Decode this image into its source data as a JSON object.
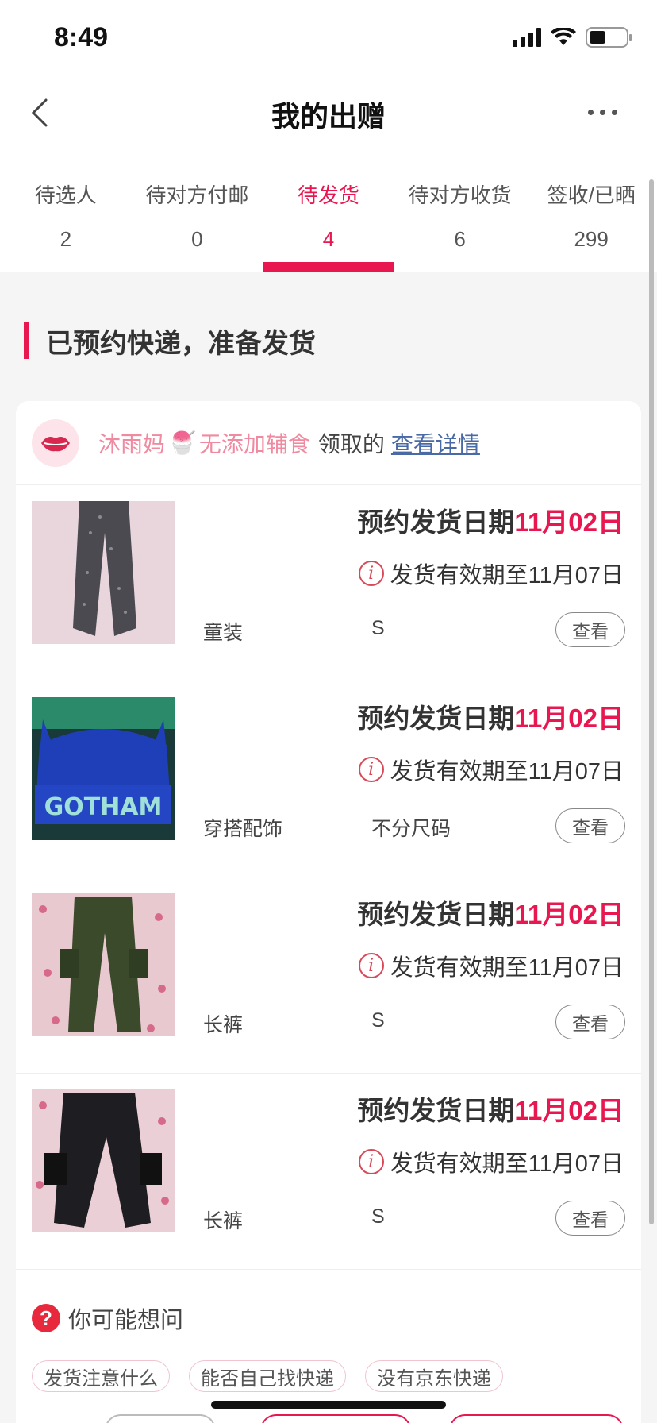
{
  "status_bar": {
    "time": "8:49",
    "battery_level": 0.45
  },
  "nav": {
    "title": "我的出赠"
  },
  "tabs": [
    {
      "label": "待选人",
      "count": "2"
    },
    {
      "label": "待对方付邮",
      "count": "0"
    },
    {
      "label": "待发货",
      "count": "4",
      "active": true
    },
    {
      "label": "待对方收货",
      "count": "6"
    },
    {
      "label": "签收/已晒",
      "count": "299"
    }
  ],
  "section": {
    "title": "已预约快递，准备发货"
  },
  "giver": {
    "name": "沐雨妈",
    "emoji": "🍧",
    "suffix": "无添加辅食",
    "action": "领取的",
    "link": "查看详情"
  },
  "items": [
    {
      "date_label": "预约发货日期",
      "date_value": "11月02日",
      "valid_text": "发货有效期至11月07日",
      "category": "童装",
      "size": "S",
      "view_label": "查看",
      "thumb": "gray-pants-icon"
    },
    {
      "date_label": "预约发货日期",
      "date_value": "11月02日",
      "valid_text": "发货有效期至11月07日",
      "category": "穿搭配饰",
      "size": "不分尺码",
      "view_label": "查看",
      "thumb": "blue-hat-icon",
      "thumb_text": "GOTHAM"
    },
    {
      "date_label": "预约发货日期",
      "date_value": "11月02日",
      "valid_text": "发货有效期至11月07日",
      "category": "长裤",
      "size": "S",
      "view_label": "查看",
      "thumb": "green-cargo-pants-icon"
    },
    {
      "date_label": "预约发货日期",
      "date_value": "11月02日",
      "valid_text": "发货有效期至11月07日",
      "category": "长裤",
      "size": "S",
      "view_label": "查看",
      "thumb": "black-cargo-pants-icon"
    }
  ],
  "faq": {
    "title": "你可能想问",
    "chips": [
      "发货注意什么",
      "能否自己找快递",
      "没有京东快递"
    ]
  },
  "colors": {
    "accent": "#e8174f",
    "link": "#4a6aa5",
    "giver": "#f08aa0"
  }
}
